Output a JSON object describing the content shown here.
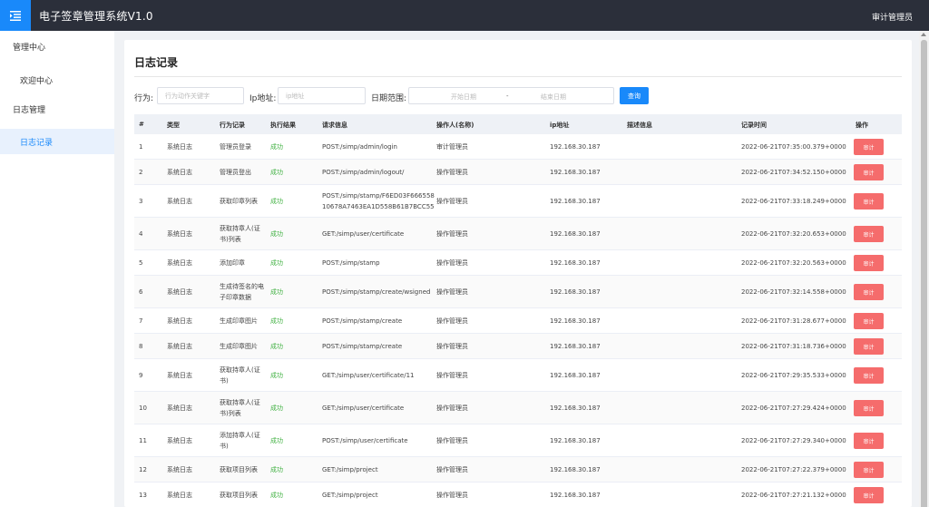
{
  "header": {
    "title": "电子签章管理系统V1.0",
    "user": "审计管理员"
  },
  "sidebar": {
    "groups": [
      {
        "label": "管理中心",
        "items": [
          "欢迎中心"
        ]
      },
      {
        "label": "日志管理",
        "items": [
          "日志记录"
        ]
      }
    ],
    "active": "日志记录"
  },
  "page": {
    "title": "日志记录"
  },
  "filters": {
    "behavior_label": "行为:",
    "behavior_placeholder": "行为动作关键字",
    "ip_label": "Ip地址:",
    "ip_placeholder": "ip地址",
    "date_label": "日期范围:",
    "date_start_placeholder": "开始日期",
    "date_sep": "-",
    "date_end_placeholder": "结束日期",
    "search_label": "查询"
  },
  "table": {
    "columns": [
      "#",
      "类型",
      "行为记录",
      "执行结果",
      "请求信息",
      "操作人(名称)",
      "ip地址",
      "描述信息",
      "记录时间",
      "操作"
    ],
    "action_label": "审计",
    "rows": [
      {
        "no": "1",
        "type": "系统日志",
        "behavior": "管理员登录",
        "result": "成功",
        "request": "POST:/simp/admin/login",
        "operator": "审计管理员",
        "ip": "192.168.30.187",
        "desc": "",
        "time": "2022-06-21T07:35:00.379+0000"
      },
      {
        "no": "2",
        "type": "系统日志",
        "behavior": "管理员登出",
        "result": "成功",
        "request": "POST:/simp/admin/logout/",
        "operator": "操作管理员",
        "ip": "192.168.30.187",
        "desc": "",
        "time": "2022-06-21T07:34:52.150+0000"
      },
      {
        "no": "3",
        "type": "系统日志",
        "behavior": "获取印章列表",
        "result": "成功",
        "request": "POST:/simp/stamp/F6ED03F666558 10678A7463EA1D558B61B7BCC55",
        "operator": "操作管理员",
        "ip": "192.168.30.187",
        "desc": "",
        "time": "2022-06-21T07:33:18.249+0000"
      },
      {
        "no": "4",
        "type": "系统日志",
        "behavior": "获取持章人(证书)列表",
        "result": "成功",
        "request": "GET:/simp/user/certificate",
        "operator": "操作管理员",
        "ip": "192.168.30.187",
        "desc": "",
        "time": "2022-06-21T07:32:20.653+0000"
      },
      {
        "no": "5",
        "type": "系统日志",
        "behavior": "添加印章",
        "result": "成功",
        "request": "POST:/simp/stamp",
        "operator": "操作管理员",
        "ip": "192.168.30.187",
        "desc": "",
        "time": "2022-06-21T07:32:20.563+0000"
      },
      {
        "no": "6",
        "type": "系统日志",
        "behavior": "生成待签名的电子印章数据",
        "result": "成功",
        "request": "POST:/simp/stamp/create/wsigned",
        "operator": "操作管理员",
        "ip": "192.168.30.187",
        "desc": "",
        "time": "2022-06-21T07:32:14.558+0000"
      },
      {
        "no": "7",
        "type": "系统日志",
        "behavior": "生成印章图片",
        "result": "成功",
        "request": "POST:/simp/stamp/create",
        "operator": "操作管理员",
        "ip": "192.168.30.187",
        "desc": "",
        "time": "2022-06-21T07:31:28.677+0000"
      },
      {
        "no": "8",
        "type": "系统日志",
        "behavior": "生成印章图片",
        "result": "成功",
        "request": "POST:/simp/stamp/create",
        "operator": "操作管理员",
        "ip": "192.168.30.187",
        "desc": "",
        "time": "2022-06-21T07:31:18.736+0000"
      },
      {
        "no": "9",
        "type": "系统日志",
        "behavior": "获取持章人(证书)",
        "result": "成功",
        "request": "GET:/simp/user/certificate/11",
        "operator": "操作管理员",
        "ip": "192.168.30.187",
        "desc": "",
        "time": "2022-06-21T07:29:35.533+0000"
      },
      {
        "no": "10",
        "type": "系统日志",
        "behavior": "获取持章人(证书)列表",
        "result": "成功",
        "request": "GET:/simp/user/certificate",
        "operator": "操作管理员",
        "ip": "192.168.30.187",
        "desc": "",
        "time": "2022-06-21T07:27:29.424+0000"
      },
      {
        "no": "11",
        "type": "系统日志",
        "behavior": "添加持章人(证书)",
        "result": "成功",
        "request": "POST:/simp/user/certificate",
        "operator": "操作管理员",
        "ip": "192.168.30.187",
        "desc": "",
        "time": "2022-06-21T07:27:29.340+0000"
      },
      {
        "no": "12",
        "type": "系统日志",
        "behavior": "获取项目列表",
        "result": "成功",
        "request": "GET:/simp/project",
        "operator": "操作管理员",
        "ip": "192.168.30.187",
        "desc": "",
        "time": "2022-06-21T07:27:22.379+0000"
      },
      {
        "no": "13",
        "type": "系统日志",
        "behavior": "获取项目列表",
        "result": "成功",
        "request": "GET:/simp/project",
        "operator": "操作管理员",
        "ip": "192.168.30.187",
        "desc": "",
        "time": "2022-06-21T07:27:21.132+0000"
      }
    ]
  },
  "colors": {
    "header_bg": "#2b2f3a",
    "accent": "#1989fa",
    "success": "#43b244",
    "danger": "#f56c6c"
  },
  "icons": {
    "menu": "hamburger-menu-icon"
  }
}
